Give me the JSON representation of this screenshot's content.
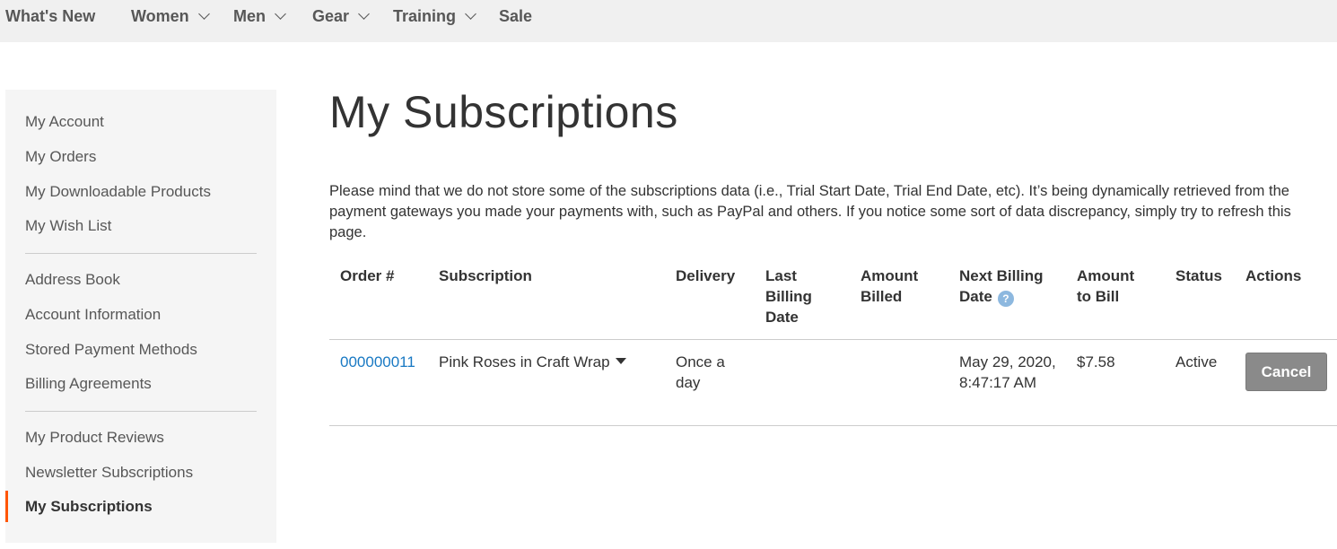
{
  "nav": {
    "items": [
      {
        "label": "What's New",
        "dropdown": false
      },
      {
        "label": "Women",
        "dropdown": true
      },
      {
        "label": "Men",
        "dropdown": true
      },
      {
        "label": "Gear",
        "dropdown": true
      },
      {
        "label": "Training",
        "dropdown": true
      },
      {
        "label": "Sale",
        "dropdown": false
      }
    ]
  },
  "sidebar": {
    "groups": [
      [
        "My Account",
        "My Orders",
        "My Downloadable Products",
        "My Wish List"
      ],
      [
        "Address Book",
        "Account Information",
        "Stored Payment Methods",
        "Billing Agreements"
      ],
      [
        "My Product Reviews",
        "Newsletter Subscriptions",
        "My Subscriptions"
      ]
    ],
    "current": "My Subscriptions",
    "accent_color": "#ff5501"
  },
  "page": {
    "title": "My Subscriptions",
    "notice": "Please mind that we do not store some of the subscriptions data (i.e., Trial Start Date, Trial End Date, etc). It’s being dynamically retrieved from the payment gateways you made your payments with, such as PayPal and others. If you notice some sort of data discrepancy, simply try to refresh this page."
  },
  "table": {
    "headers": {
      "order": "Order #",
      "subscription": "Subscription",
      "delivery": "Delivery",
      "last_billing": "Last Billing Date",
      "amount_billed": "Amount Billed",
      "next_billing": "Next Billing Date",
      "amount_to_bill": "Amount to Bill",
      "status": "Status",
      "actions": "Actions"
    },
    "help_icon": "question-icon",
    "rows": [
      {
        "order": "000000011",
        "subscription": "Pink Roses in Craft Wrap",
        "delivery": "Once a day",
        "last_billing": "",
        "amount_billed": "",
        "next_billing": "May 29, 2020, 8:47:17 AM",
        "amount_to_bill": "$7.58",
        "status": "Active",
        "action_label": "Cancel"
      }
    ]
  },
  "colors": {
    "link": "#1979c3",
    "nav_bg": "#f0f0f0",
    "sidebar_bg": "#f5f5f5",
    "button_bg": "#8a8a8a"
  }
}
